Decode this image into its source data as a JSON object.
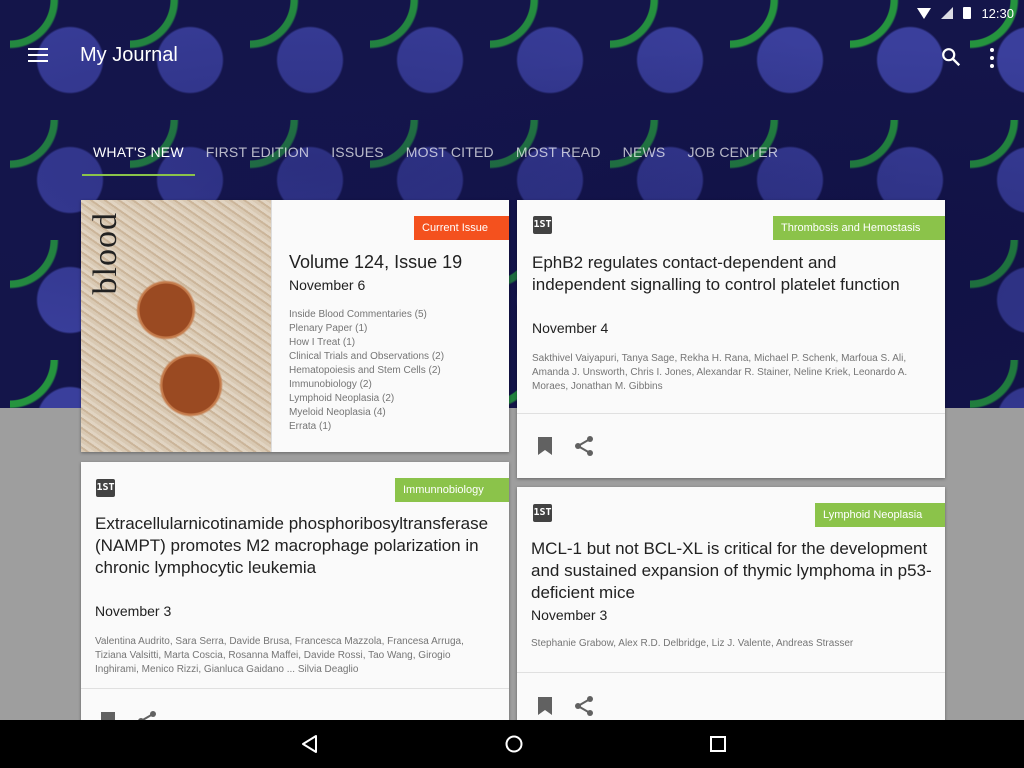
{
  "status_bar": {
    "time": "12:30",
    "icons": [
      "wifi-icon",
      "signal-icon",
      "battery-icon"
    ]
  },
  "app_bar": {
    "title": "My Journal",
    "icons": [
      "menu-icon",
      "search-icon",
      "more-vert-icon"
    ]
  },
  "tabs": [
    {
      "label": "WHAT'S NEW",
      "active": true
    },
    {
      "label": "FIRST EDITION"
    },
    {
      "label": "ISSUES"
    },
    {
      "label": "MOST CITED"
    },
    {
      "label": "MOST READ"
    },
    {
      "label": "NEWS"
    },
    {
      "label": "JOB CENTER"
    }
  ],
  "issue_card": {
    "cover_title": "blood",
    "tag": "Current Issue",
    "title": "Volume 124, Issue 19",
    "date": "November 6",
    "toc": [
      "Inside Blood Commentaries (5)",
      "Plenary Paper (1)",
      "How I Treat (1)",
      "Clinical Trials and Observations (2)",
      "Hematopoiesis and Stem Cells (2)",
      "Immunobiology (2)",
      "Lymphoid Neoplasia (2)",
      "Myeloid Neoplasia (4)",
      "Errata (1)"
    ]
  },
  "articles": [
    {
      "tag": "Thrombosis and Hemostasis",
      "title": "EphB2 regulates contact-dependent and independent signalling to control platelet function",
      "date": "November 4",
      "authors": "Sakthivel Vaiyapuri, Tanya Sage, Rekha H. Rana, Michael P. Schenk, Marfoua S. Ali, Amanda J. Unsworth, Chris I. Jones, Alexandar R. Stainer, Neline Kriek, Leonardo A. Moraes, Jonathan M. Gibbins"
    },
    {
      "tag": "Immunnobiology",
      "title": "Extracellularnicotinamide phosphoribosyltransferase (NAMPT) promotes M2 macrophage polarization in chronic lymphocytic leukemia",
      "date": "November 3",
      "authors": "Valentina Audrito, Sara Serra, Davide Brusa, Francesca Mazzola, Francesa Arruga, Tiziana Valsitti, Marta Coscia, Rosanna Maffei, Davide Rossi, Tao Wang, Girogio Inghirami, Menico Rizzi, Gianluca Gaidano ... Silvia Deaglio"
    },
    {
      "tag": "Lymphoid Neoplasia",
      "title": "MCL-1 but not BCL-XL is critical for the development and sustained expansion of thymic lymphoma in p53-deficient mice",
      "date": "November 3",
      "authors": "Stephanie Grabow, Alex R.D. Delbridge, Liz J. Valente, Andreas Strasser"
    }
  ],
  "journal_icon_text": "1ST",
  "nav_bar": {
    "icons": [
      "back-icon",
      "home-icon",
      "recents-icon"
    ]
  },
  "colors": {
    "accent": "#8bc34a",
    "tag_orange": "#f4511e",
    "tag_green": "#8bc34a"
  }
}
